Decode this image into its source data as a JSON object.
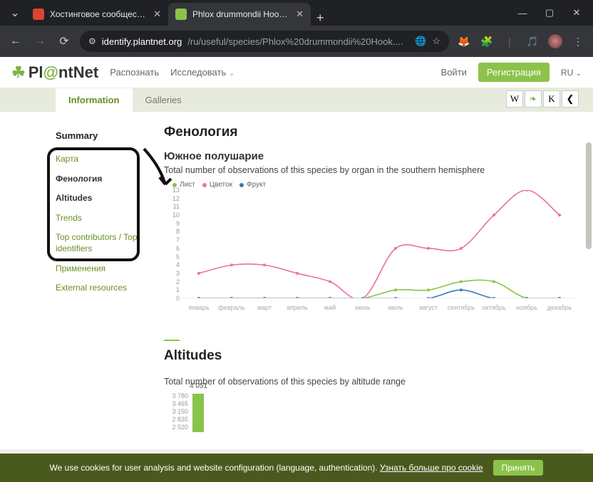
{
  "browser": {
    "tabs": [
      {
        "title": "Хостинговое сообщество «Tim",
        "active": false
      },
      {
        "title": "Phlox drummondii Hook., Флок",
        "active": true
      }
    ],
    "url_host": "identify.plantnet.org",
    "url_path": "/ru/useful/species/Phlox%20drummondii%20Hook....",
    "win": {
      "min": "—",
      "max": "▢",
      "close": "✕"
    },
    "newtab": "+",
    "chev": "⌄"
  },
  "header": {
    "logo_pre": "Pl",
    "logo_at": "@",
    "logo_post": "ntNet",
    "nav": {
      "identify": "Распознать",
      "explore": "Исследовать"
    },
    "login": "Войти",
    "register": "Регистрация",
    "lang": "RU"
  },
  "page_tabs": {
    "info": "Information",
    "galleries": "Galleries"
  },
  "share": {
    "w": "W",
    "leaf": "❧",
    "k": "K",
    "share": "❮"
  },
  "sidebar": {
    "summary": "Summary",
    "items": [
      "Карта",
      "Фенология",
      "Altitudes",
      "Trends",
      "Top contributors / Top identifiers",
      "Применения",
      "External resources"
    ]
  },
  "section": {
    "phenology_title": "Фенология",
    "hemi_title": "Южное полушарие",
    "hemi_desc": "Total number of observations of this species by organ in the southern hemisphere",
    "altitudes_title": "Altitudes",
    "altitudes_desc": "Total number of observations of this species by altitude range"
  },
  "chart_data": {
    "type": "line",
    "title": "Южное полушарие",
    "xlabel": "",
    "ylabel": "",
    "ylim": [
      0,
      13
    ],
    "yticks": [
      0,
      1,
      2,
      3,
      4,
      5,
      6,
      7,
      8,
      9,
      10,
      11,
      12,
      13
    ],
    "categories": [
      "январь",
      "февраль",
      "март",
      "апрель",
      "май",
      "июнь",
      "июль",
      "август",
      "сентябрь",
      "октябрь",
      "ноябрь",
      "декабрь"
    ],
    "series": [
      {
        "name": "Лист",
        "color": "#8bc34a",
        "values": [
          0,
          0,
          0,
          0,
          0,
          0,
          1,
          1,
          2,
          2,
          0,
          0
        ]
      },
      {
        "name": "Цветок",
        "color": "#ec6fa8",
        "values": [
          3,
          4,
          4,
          3,
          2,
          0,
          6,
          6,
          6,
          10,
          13,
          10
        ]
      },
      {
        "name": "Фрукт",
        "color": "#3a7bbf",
        "values": [
          0,
          0,
          0,
          0,
          0,
          0,
          0,
          0,
          1,
          0,
          0,
          0
        ]
      }
    ]
  },
  "alt_chart": {
    "yticks": [
      "3 780",
      "3 465",
      "3 150",
      "2 835",
      "2 520"
    ],
    "first_bar_value": "4 051"
  },
  "cookie": {
    "text": "We use cookies for user analysis and website configuration (language, authentication).",
    "more": "Узнать больше про cookie",
    "accept": "Принять"
  }
}
